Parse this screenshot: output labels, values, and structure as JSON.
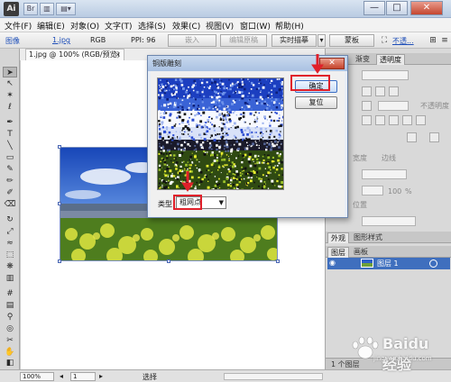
{
  "app": {
    "logo_text": "Ai"
  },
  "menu": [
    "文件(F)",
    "编辑(E)",
    "对象(O)",
    "文字(T)",
    "选择(S)",
    "效果(C)",
    "视图(V)",
    "窗口(W)",
    "帮助(H)"
  ],
  "controlbar": {
    "object_type": "图像",
    "filename": "1.jpg",
    "color_mode": "RGB",
    "ppi": "PPI: 96",
    "embed_label": "嵌入",
    "edit_original_label": "编辑原稿",
    "live_trace_label": "实时描摹",
    "mask_label": "蒙板",
    "opacity_label": "不透..."
  },
  "document": {
    "tab_title": "1.jpg @ 100% (RGB/预览)",
    "tab_close": "×"
  },
  "dialog": {
    "title": "铜版雕刻",
    "ok_label": "确定",
    "reset_label": "复位",
    "type_label": "类型",
    "type_value": "粗网点",
    "close_glyph": "✕"
  },
  "panels": {
    "top_tabs": [
      "渐变",
      "透明度"
    ],
    "layers_tabs": [
      "图层",
      "画板"
    ],
    "layer_name": "图层 1",
    "layers_count": "1 个图层",
    "appearance_tabs": [
      "外观",
      "图形样式"
    ],
    "dim_labels": [
      "宽度",
      "边线",
      "不透明度",
      "位置",
      "100",
      "%"
    ]
  },
  "statusbar": {
    "zoom": "100%",
    "page": "1",
    "tool": "选择"
  },
  "watermark": {
    "text": "Baidu 经验",
    "sub": "jingyan.baidu.com"
  },
  "colors": {
    "title_bar": "#b9cbe2",
    "layer_selected": "#3f6fbe",
    "highlight": "#e0202a"
  }
}
